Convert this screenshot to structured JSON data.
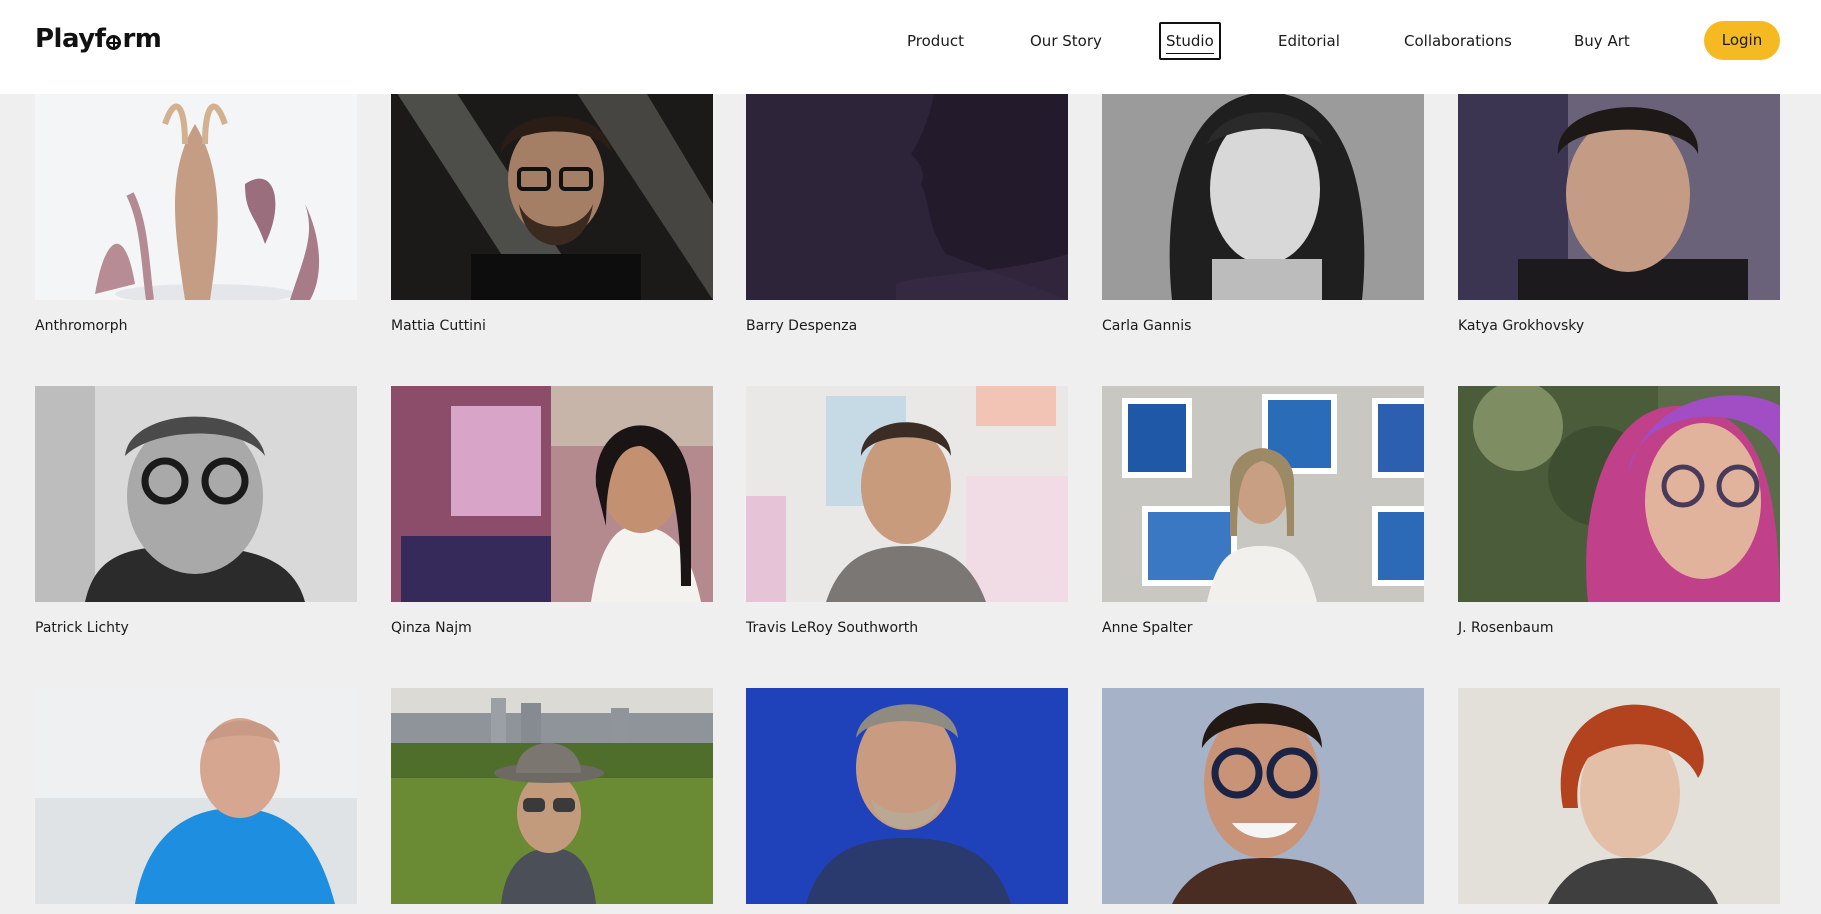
{
  "brand": {
    "logo_text_pre": "Playf",
    "logo_text_post": "rm"
  },
  "nav": {
    "items": [
      {
        "label": "Product"
      },
      {
        "label": "Our Story"
      },
      {
        "label": "Studio"
      },
      {
        "label": "Editorial"
      },
      {
        "label": "Collaborations"
      },
      {
        "label": "Buy Art"
      }
    ],
    "login_label": "Login"
  },
  "artists": [
    {
      "name": "Anthromorph"
    },
    {
      "name": "Mattia Cuttini"
    },
    {
      "name": "Barry Despenza"
    },
    {
      "name": "Carla Gannis"
    },
    {
      "name": "Katya Grokhovsky"
    },
    {
      "name": "Patrick Lichty"
    },
    {
      "name": "Qinza Najm"
    },
    {
      "name": "Travis LeRoy Southworth"
    },
    {
      "name": "Anne Spalter"
    },
    {
      "name": "J. Rosenbaum"
    },
    {
      "name": ""
    },
    {
      "name": ""
    },
    {
      "name": ""
    },
    {
      "name": ""
    },
    {
      "name": ""
    }
  ],
  "colors": {
    "accent": "#f5b921",
    "background": "#efefef",
    "header": "#ffffff"
  }
}
